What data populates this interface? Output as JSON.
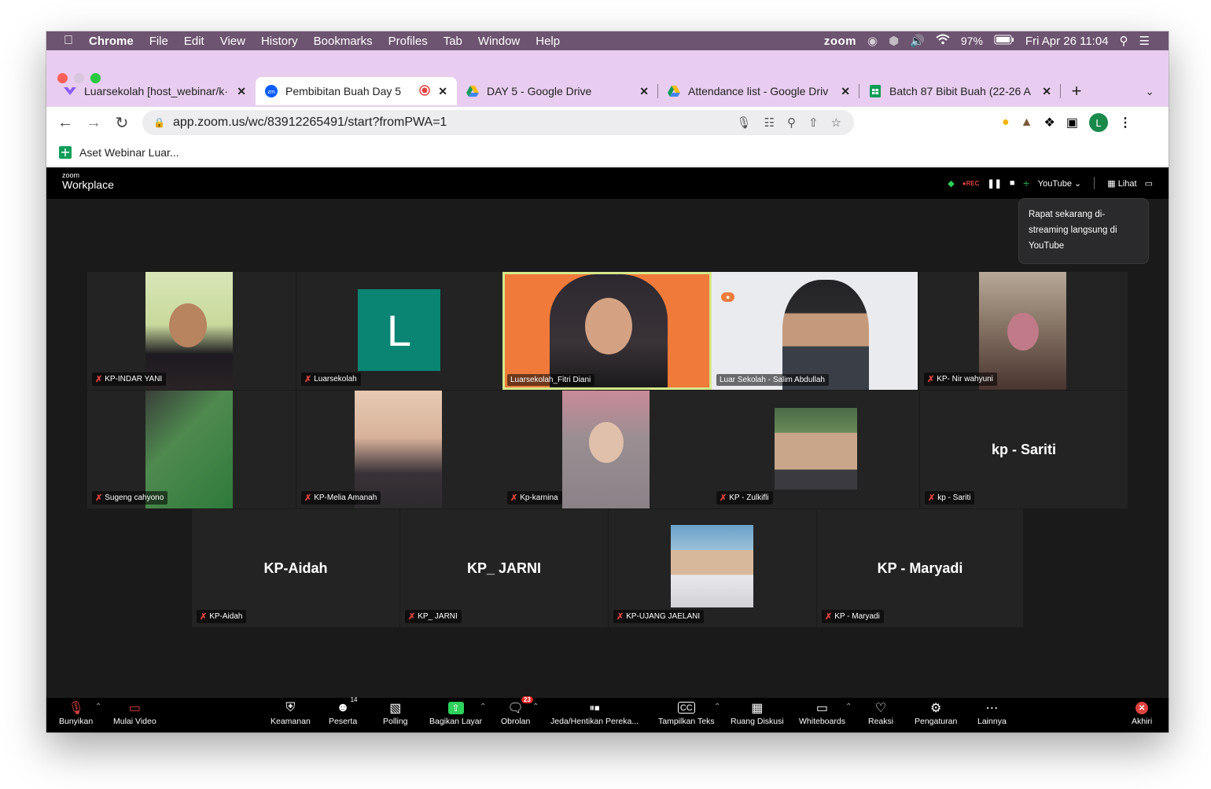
{
  "menubar": {
    "app": "Chrome",
    "items": [
      "File",
      "Edit",
      "View",
      "History",
      "Bookmarks",
      "Profiles",
      "Tab",
      "Window",
      "Help"
    ],
    "zoom_label": "zoom",
    "battery": "97%",
    "datetime": "Fri Apr 26  11:04"
  },
  "tabs": [
    {
      "title": "Luarsekolah [host_webinar/k·",
      "icon": "tab-luarsekolah-icon"
    },
    {
      "title": "Pembibitan Buah Day 5",
      "icon": "zoom-favicon-icon"
    },
    {
      "title": "DAY 5 - Google Drive",
      "icon": "google-drive-icon"
    },
    {
      "title": "Attendance list - Google Driv",
      "icon": "google-drive-icon"
    },
    {
      "title": "Batch 87 Bibit Buah (22-26 A",
      "icon": "google-sheets-icon"
    }
  ],
  "url": "app.zoom.us/wc/83912265491/start?fromPWA=1",
  "profile_initial": "L",
  "bookmark": "Aset Webinar Luar...",
  "zoom": {
    "brand_small": "zoom",
    "brand": "Workplace",
    "rec": "REC",
    "youtube": "YouTube",
    "view": "Lihat",
    "tooltip": "Rapat sekarang di-streaming langsung di YouTube",
    "avatar_letter": "L"
  },
  "participants": [
    {
      "name": "KP-INDAR YANI"
    },
    {
      "name": "Luarsekolah"
    },
    {
      "name": "Luarsekolah_Fitri Diani"
    },
    {
      "name": "Luar Sekolah - Salim Abdullah"
    },
    {
      "name": "KP- Nir wahyuni"
    },
    {
      "name": "Sugeng cahyono"
    },
    {
      "name": "KP-Melia Amanah"
    },
    {
      "name": "Kp-karnina"
    },
    {
      "name": "KP - Zulkifli"
    },
    {
      "name": "kp - Sariti"
    },
    {
      "name": "KP-Aidah"
    },
    {
      "name": "KP_ JARNI"
    },
    {
      "name": "KP-UJANG JAELANI"
    },
    {
      "name": "KP - Maryadi"
    }
  ],
  "controls": {
    "unmute": "Bunyikan",
    "video": "Mulai Video",
    "security": "Keamanan",
    "participants": "Peserta",
    "participants_count": "14",
    "polling": "Polling",
    "share": "Bagikan Layar",
    "chat": "Obrolan",
    "chat_badge": "23",
    "record": "Jeda/Hentikan Pereka...",
    "captions": "Tampilkan Teks",
    "breakout": "Ruang Diskusi",
    "whiteboards": "Whiteboards",
    "reactions": "Reaksi",
    "settings": "Pengaturan",
    "more": "Lainnya",
    "end": "Akhiri"
  }
}
